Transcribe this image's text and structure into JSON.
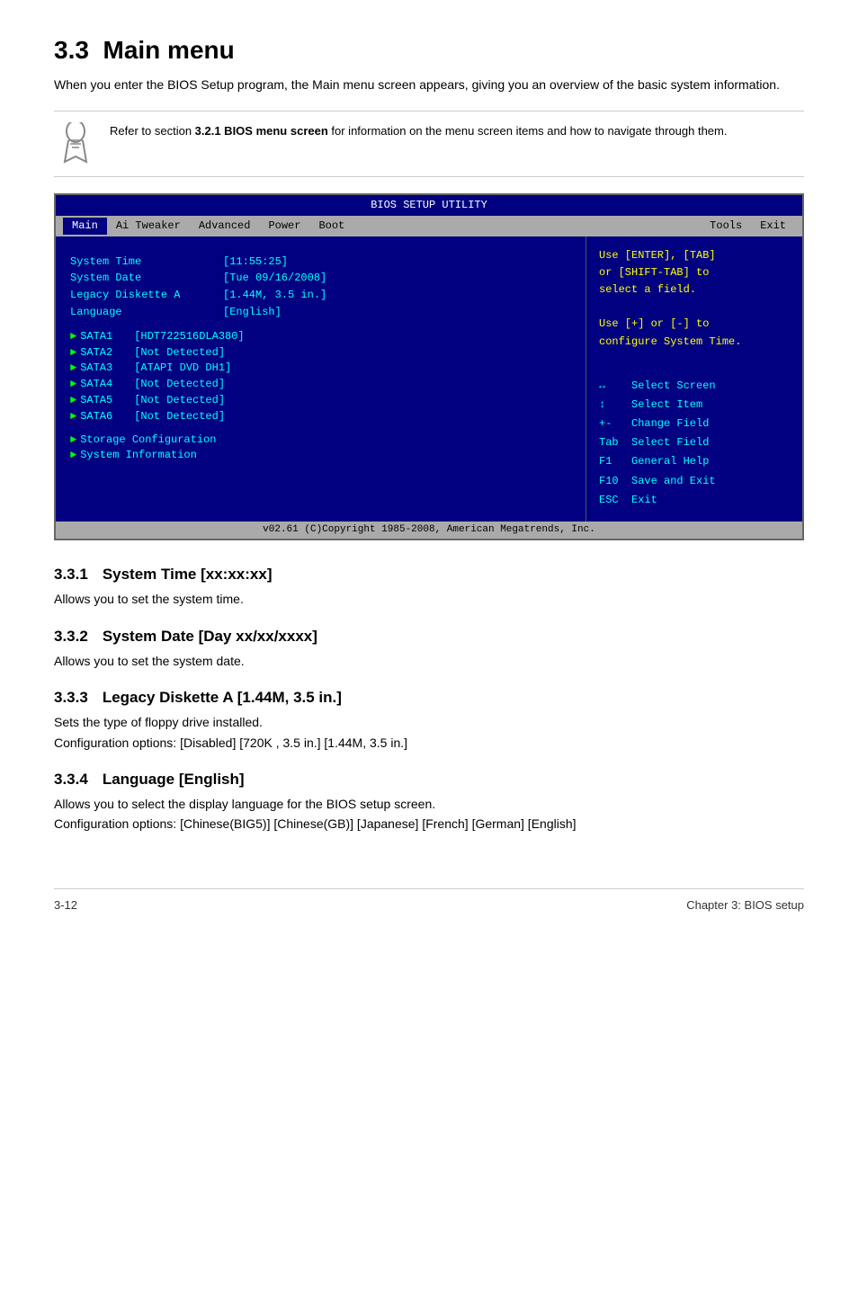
{
  "page": {
    "section_number": "3.3",
    "section_title": "Main menu",
    "intro": "When you enter the BIOS Setup program, the Main menu screen appears, giving you an overview of the basic system information.",
    "note": "Refer to section 3.2.1 BIOS menu screen for information on the menu screen items and how to navigate through them.",
    "note_bold": "3.2.1 BIOS menu screen"
  },
  "bios": {
    "title": "BIOS SETUP UTILITY",
    "menu_items": [
      "Main",
      "Ai Tweaker",
      "Advanced",
      "Power",
      "Boot",
      "Tools",
      "Exit"
    ],
    "active_menu": "Main",
    "fields": [
      {
        "name": "System Time",
        "value": "[11:55:25]"
      },
      {
        "name": "System Date",
        "value": "[Tue 09/16/2008]"
      },
      {
        "name": "Legacy Diskette A",
        "value": "[1.44M, 3.5 in.]"
      },
      {
        "name": "Language",
        "value": "[English]"
      }
    ],
    "sata_items": [
      {
        "label": "SATA1",
        "value": "[HDT722516DLA380]"
      },
      {
        "label": "SATA2",
        "value": "[Not Detected]"
      },
      {
        "label": "SATA3",
        "value": "[ATAPI DVD DH1]"
      },
      {
        "label": "SATA4",
        "value": "[Not Detected]"
      },
      {
        "label": "SATA5",
        "value": "[Not Detected]"
      },
      {
        "label": "SATA6",
        "value": "[Not Detected]"
      }
    ],
    "sub_items": [
      "Storage Configuration",
      "System Information"
    ],
    "help_top": [
      "Use [ENTER], [TAB]",
      "or [SHIFT-TAB] to",
      "select a field.",
      "",
      "Use [+] or [-] to",
      "configure System Time."
    ],
    "help_bottom": [
      {
        "key": "↔",
        "desc": "Select Screen"
      },
      {
        "key": "↑↓",
        "desc": "Select Item"
      },
      {
        "key": "+-",
        "desc": "Change Field"
      },
      {
        "key": "Tab",
        "desc": "Select Field"
      },
      {
        "key": "F1",
        "desc": "General Help"
      },
      {
        "key": "F10",
        "desc": "Save and Exit"
      },
      {
        "key": "ESC",
        "desc": "Exit"
      }
    ],
    "footer": "v02.61 (C)Copyright 1985-2008, American Megatrends, Inc."
  },
  "subsections": [
    {
      "number": "3.3.1",
      "title": "System Time [xx:xx:xx]",
      "body": "Allows you to set the system time."
    },
    {
      "number": "3.3.2",
      "title": "System Date [Day xx/xx/xxxx]",
      "body": "Allows you to set the system date."
    },
    {
      "number": "3.3.3",
      "title": "Legacy Diskette A [1.44M, 3.5 in.]",
      "body": "Sets the type of floppy drive installed.",
      "body2": "Configuration options: [Disabled] [720K , 3.5 in.] [1.44M, 3.5 in.]"
    },
    {
      "number": "3.3.4",
      "title": "Language [English]",
      "body": "Allows you to select the display language for the BIOS setup screen.",
      "body2": "Configuration options: [Chinese(BIG5)] [Chinese(GB)] [Japanese] [French] [German] [English]"
    }
  ],
  "footer": {
    "left": "3-12",
    "right": "Chapter 3: BIOS setup"
  }
}
